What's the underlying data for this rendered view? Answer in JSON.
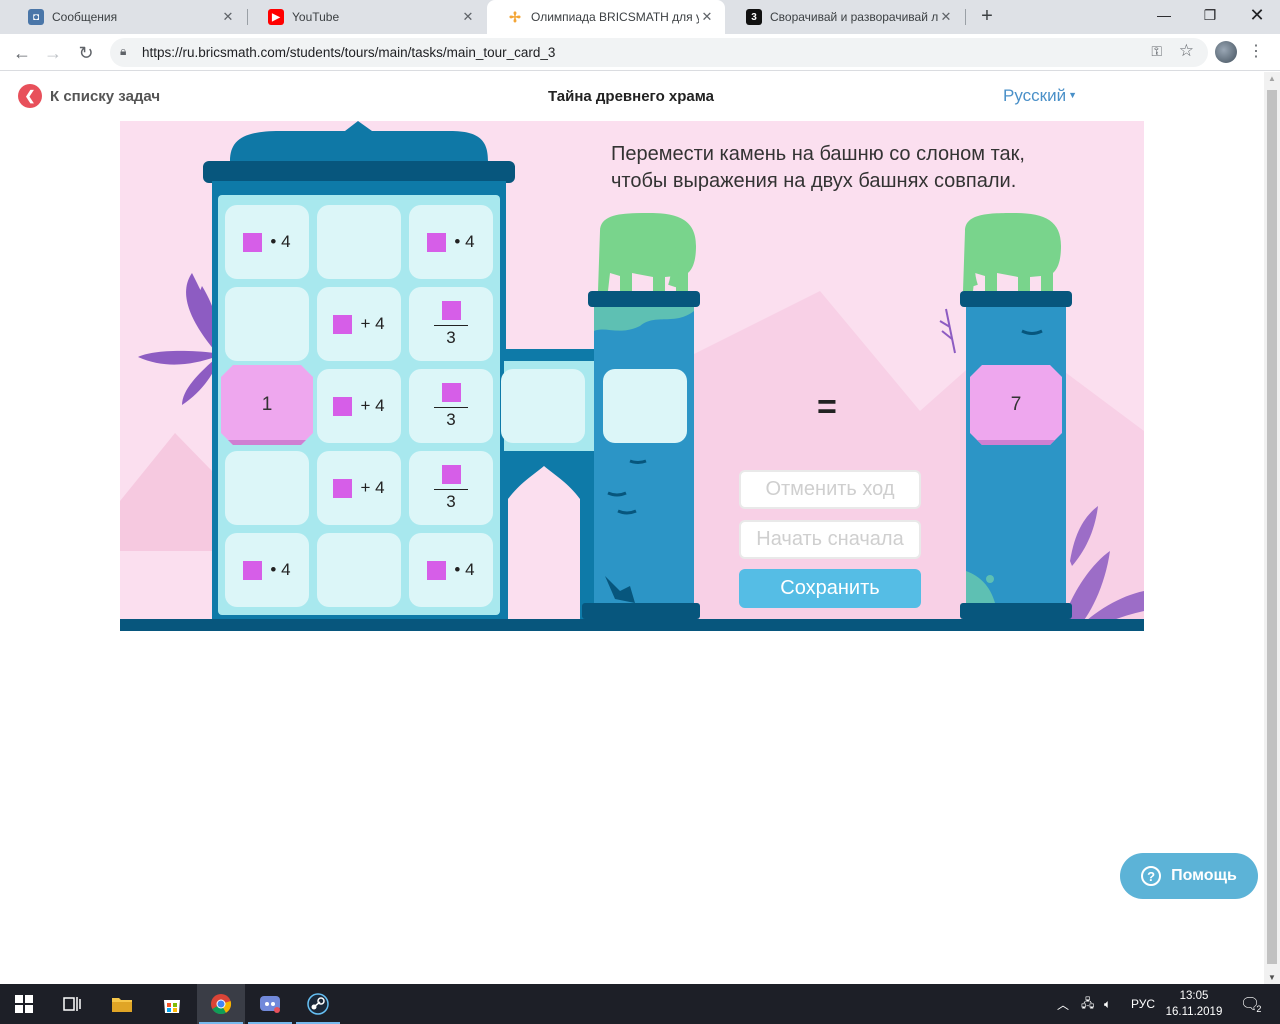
{
  "browser": {
    "tabs": [
      {
        "title": "Сообщения",
        "icon": "vk-messages-icon",
        "color": "#4a76a8"
      },
      {
        "title": "YouTube",
        "icon": "youtube-icon",
        "color": "#ff0000"
      },
      {
        "title": "Олимпиада BRICSMATH для уче",
        "icon": "bricsmath-icon",
        "color": "#f3a536"
      },
      {
        "title": "Сворачивай и разворачивай ли",
        "icon": "three-icon",
        "color": "#111111"
      }
    ],
    "active_tab": 2,
    "url": "https://ru.bricsmath.com/students/tours/main/tasks/main_tour_card_3"
  },
  "header": {
    "back_label": "К списку задач",
    "title": "Тайна древнего храма",
    "language": "Русский"
  },
  "task": {
    "instruction": "Перемести камень на башню со слоном так, чтобы выражения на двух башнях совпали.",
    "cells": {
      "r1c1": "• 4",
      "r1c3": "• 4",
      "r2c2": "+ 4",
      "r2c3_den": "3",
      "r3c2": "+ 4",
      "r3c3_den": "3",
      "r4c2": "+ 4",
      "r4c3_den": "3",
      "r5c1": "• 4",
      "r5c3": "• 4"
    },
    "stone_value": "1",
    "right_tower_value": "7",
    "equals": "=",
    "buttons": {
      "undo": "Отменить ход",
      "restart": "Начать сначала",
      "save": "Сохранить"
    }
  },
  "help": {
    "label": "Помощь"
  },
  "taskbar": {
    "lang": "РУС",
    "time": "13:05",
    "date": "16.11.2019",
    "notifications": "2"
  },
  "colors": {
    "accent": "#55bde5",
    "stone": "#eea7ee",
    "variable_square": "#d65ee8",
    "back_button": "#e8505b",
    "building": "#0e7aa8",
    "tower": "#2c95c6"
  }
}
